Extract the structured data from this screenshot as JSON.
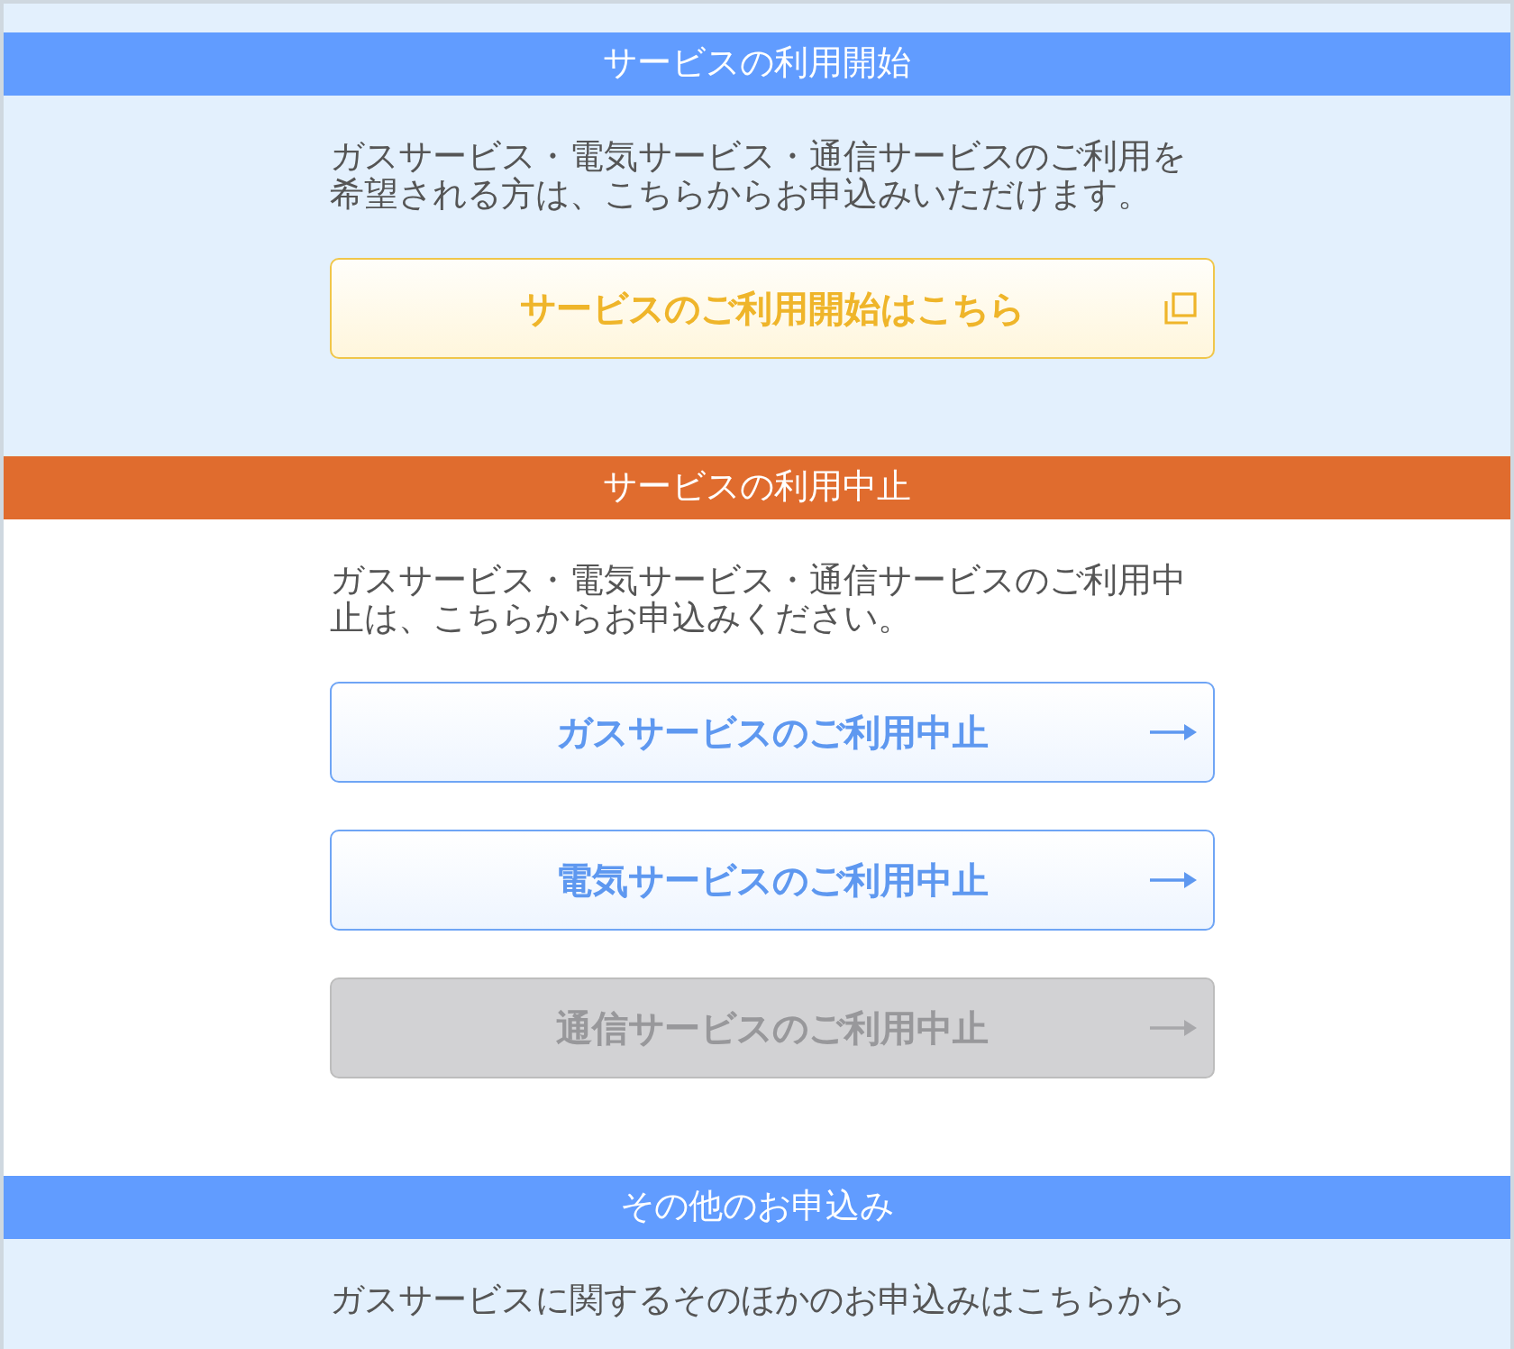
{
  "sections": [
    {
      "kind": "apply",
      "title": "サービスの利用開始",
      "text": "ガスサービス・電気サービス・通信サービスのご利用を希望される方は、こちらからお申込みいただけます。",
      "buttons": [
        {
          "kind": "external",
          "label": "サービスのご利用開始はこちら",
          "disabled": false
        }
      ]
    },
    {
      "kind": "cancel",
      "title": "サービスの利用中止",
      "text": "ガスサービス・電気サービス・通信サービスのご利用中止は、こちらからお申込みください。",
      "buttons": [
        {
          "kind": "arrow",
          "label": "ガスサービスのご利用中止",
          "disabled": false
        },
        {
          "kind": "arrow",
          "label": "電気サービスのご利用中止",
          "disabled": false
        },
        {
          "kind": "arrow",
          "label": "通信サービスのご利用中止",
          "disabled": true
        }
      ]
    },
    {
      "kind": "apply",
      "title": "その他のお申込み",
      "text": "ガスサービスに関するそのほかのお申込みはこちらから"
    }
  ]
}
